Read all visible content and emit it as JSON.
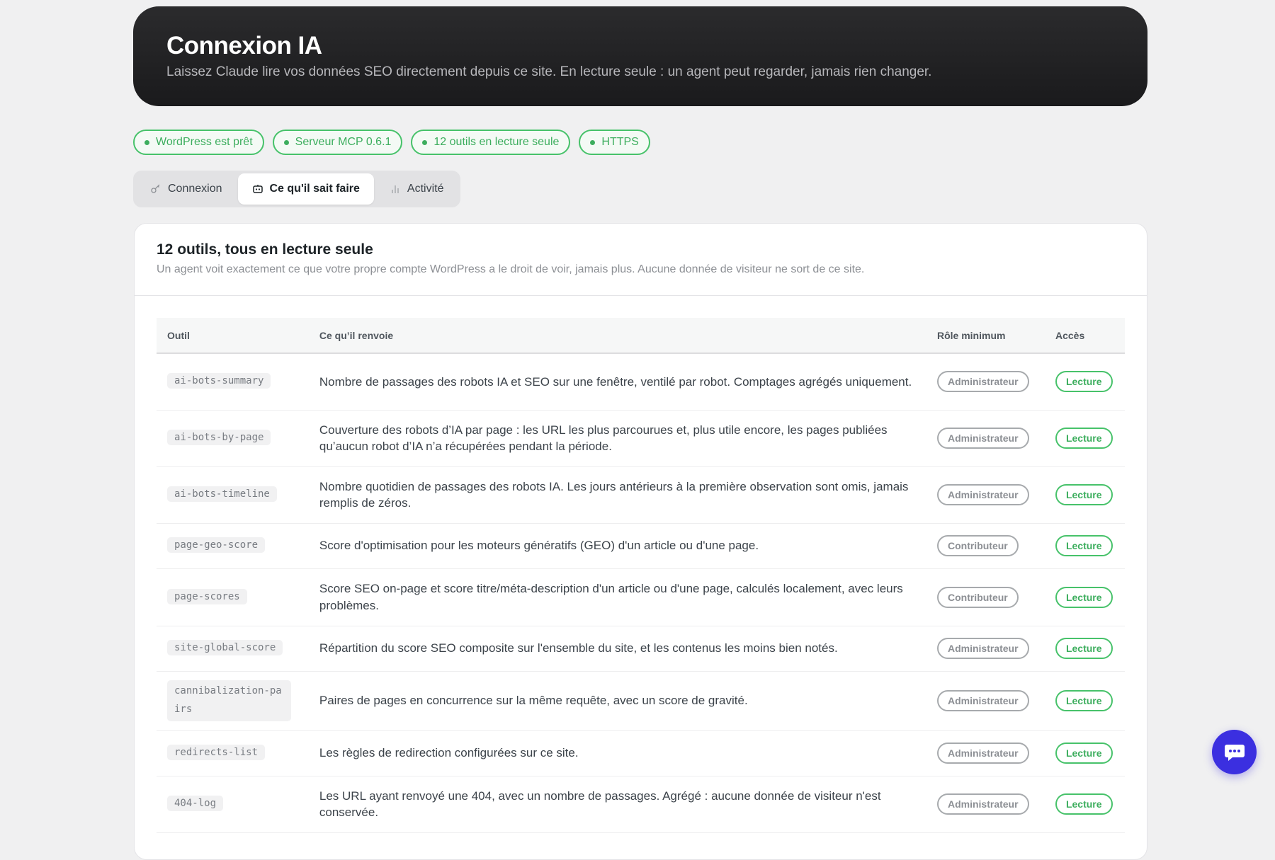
{
  "hero": {
    "title": "Connexion IA",
    "subtitle": "Laissez Claude lire vos données SEO directement depuis ce site. En lecture seule : un agent peut regarder, jamais rien changer."
  },
  "badges": [
    "WordPress est prêt",
    "Serveur MCP 0.6.1",
    "12 outils en lecture seule",
    "HTTPS"
  ],
  "tabs": [
    {
      "label": "Connexion",
      "icon": "key-icon",
      "active": false
    },
    {
      "label": "Ce qu'il sait faire",
      "icon": "robot-icon",
      "active": true
    },
    {
      "label": "Activité",
      "icon": "bar-chart-icon",
      "active": false
    }
  ],
  "card": {
    "title": "12 outils, tous en lecture seule",
    "subtitle": "Un agent voit exactement ce que votre propre compte WordPress a le droit de voir, jamais plus. Aucune donnée de visiteur ne sort de ce site."
  },
  "table": {
    "headers": [
      "Outil",
      "Ce qu’il renvoie",
      "Rôle minimum",
      "Accès"
    ],
    "rows": [
      {
        "tool": "ai-bots-summary",
        "desc": "Nombre de passages des robots IA et SEO sur une fenêtre, ventilé par robot. Comptages agrégés uniquement.",
        "role": "Administrateur",
        "access": "Lecture"
      },
      {
        "tool": "ai-bots-by-page",
        "desc": "Couverture des robots d’IA par page : les URL les plus parcourues et, plus utile encore, les pages publiées qu’aucun robot d’IA n’a récupérées pendant la période.",
        "role": "Administrateur",
        "access": "Lecture"
      },
      {
        "tool": "ai-bots-timeline",
        "desc": "Nombre quotidien de passages des robots IA. Les jours antérieurs à la première observation sont omis, jamais remplis de zéros.",
        "role": "Administrateur",
        "access": "Lecture"
      },
      {
        "tool": "page-geo-score",
        "desc": "Score d'optimisation pour les moteurs génératifs (GEO) d'un article ou d'une page.",
        "role": "Contributeur",
        "access": "Lecture"
      },
      {
        "tool": "page-scores",
        "desc": "Score SEO on-page et score titre/méta-description d'un article ou d'une page, calculés localement, avec leurs problèmes.",
        "role": "Contributeur",
        "access": "Lecture"
      },
      {
        "tool": "site-global-score",
        "desc": "Répartition du score SEO composite sur l'ensemble du site, et les contenus les moins bien notés.",
        "role": "Administrateur",
        "access": "Lecture"
      },
      {
        "tool": "cannibalization-pairs",
        "desc": "Paires de pages en concurrence sur la même requête, avec un score de gravité.",
        "role": "Administrateur",
        "access": "Lecture"
      },
      {
        "tool": "redirects-list",
        "desc": "Les règles de redirection configurées sur ce site.",
        "role": "Administrateur",
        "access": "Lecture"
      },
      {
        "tool": "404-log",
        "desc": "Les URL ayant renvoyé une 404, avec un nombre de passages. Agrégé : aucune donnée de visiteur n'est conservée.",
        "role": "Administrateur",
        "access": "Lecture"
      }
    ]
  },
  "colors": {
    "accent": "#3dae5e",
    "hero_bg": "#1a1a1c",
    "chat_button": "#3b2fe0"
  }
}
